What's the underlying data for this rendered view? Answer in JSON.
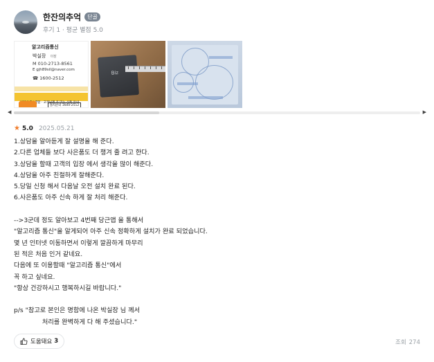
{
  "author": {
    "name": "한잔의추억",
    "badge": "단골",
    "meta": "후기 1 · 평균 별점 5.0"
  },
  "photos": [
    {
      "icon": "business-card-photo",
      "title": "알고리즘통신",
      "name": "박실장",
      "role": "이장",
      "phone": "M 010-2713-8561",
      "email": "E gjh89sil@naver.com",
      "tel": "☎ 1600-2512",
      "band": "인터넷 TV 결합 · 고객님께 꼭 맞는 상품 안내",
      "button": "설치문의 1600-2512"
    },
    {
      "icon": "router-device-photo",
      "device_label": "Biz"
    },
    {
      "icon": "paper-document-photo"
    }
  ],
  "review": {
    "score": "5.0",
    "date": "2025.05.21",
    "lines": [
      "1.상담을 알아듣게 잘 설명을 해 준다.",
      "2.다른 업체들 보다 사은품도 더 챙겨 줄 려고 한다.",
      "3.상담을 할때 고객의 입장 에서 생각을 많이 해준다.",
      "4.상담을 아주 친절하게 잘해준다.",
      "5.당일 신청 해서 다음날 오전 설치 완료 된다.",
      "6.사은품도 아주 신속 하게 잘 처리 해준다.",
      "",
      "-->3군데 정도 알아보고 4번째 당근앱 을 통해서",
      "\"알고리즘 통신\"을 알게되어 아주 신속 정확하게 설치가 완료 되었습니다.",
      "몇 년 인터넷 이동하면서 이렇게 깔끔하게 마무리",
      "된 적은 처음 인거 같네요.",
      "다음에 또 이용할때 \"알고리즘 통신\"에서",
      "꼭 하고 싶네요.",
      "\"항상 건강하시고 행복하시길 바랍니다.\"",
      "",
      "p/s \"참고로 본인은 명함에 나온 박실장 님 께서",
      "              처리를 완벽하게 다 해 주셨습니다.\""
    ]
  },
  "helpful": {
    "label": "도움돼요",
    "count": "3"
  },
  "views": {
    "label": "조회",
    "count": "274"
  },
  "colors": {
    "star": "#f07c2a",
    "badge": "#7a8592",
    "card_band": "#f4c430"
  }
}
